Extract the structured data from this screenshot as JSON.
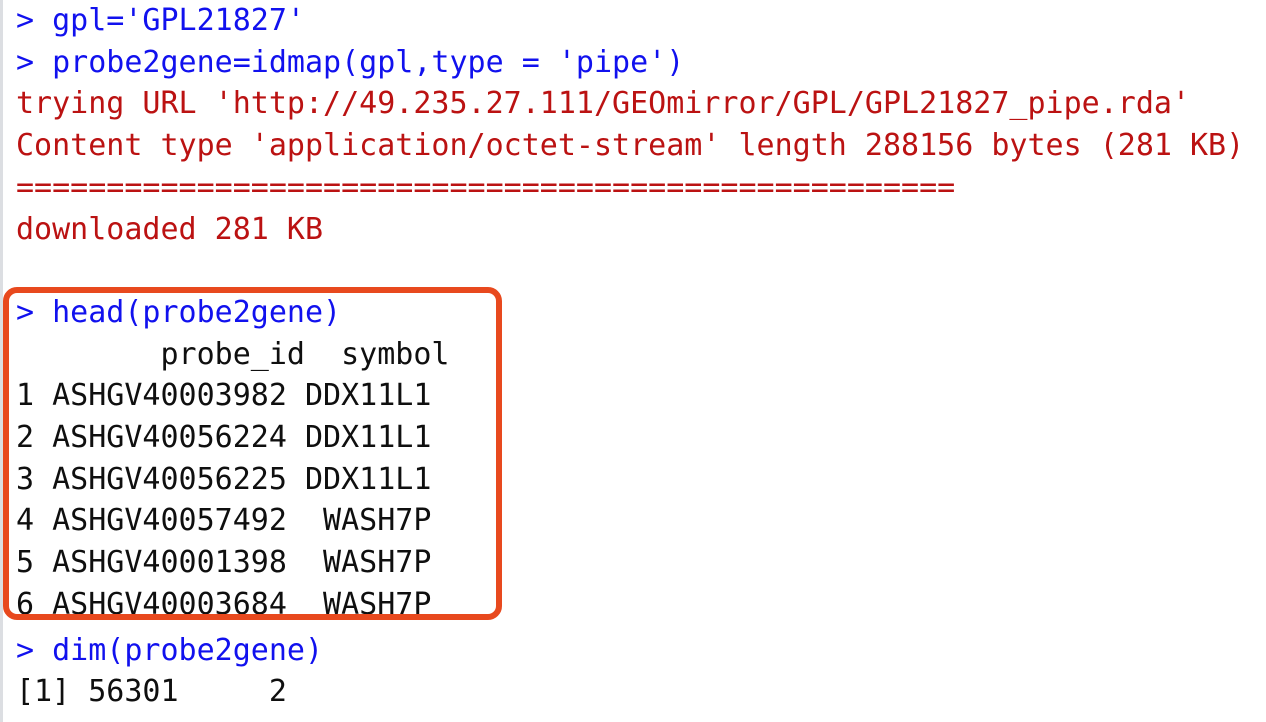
{
  "colors": {
    "command_blue": "#1111ee",
    "output_red": "#bb1212",
    "output_black": "#0f0f0f",
    "highlight_orange": "#e8491e",
    "background": "#ffffff",
    "gutter_gray": "#dcdee2"
  },
  "console": {
    "prompt_symbol": ">",
    "lines": [
      {
        "kind": "command",
        "text": "> gpl='GPL21827'"
      },
      {
        "kind": "command",
        "text": "> probe2gene=idmap(gpl,type = 'pipe')"
      },
      {
        "kind": "output_red",
        "text": "trying URL 'http://49.235.27.111/GEOmirror/GPL/GPL21827_pipe.rda'"
      },
      {
        "kind": "output_red",
        "text": "Content type 'application/octet-stream' length 288156 bytes (281 KB)"
      },
      {
        "kind": "output_red",
        "text": "===================================================="
      },
      {
        "kind": "output_red",
        "text": "downloaded 281 KB"
      },
      {
        "kind": "blank",
        "text": ""
      },
      {
        "kind": "command",
        "text": "> head(probe2gene)"
      },
      {
        "kind": "output_black",
        "text": "        probe_id  symbol"
      },
      {
        "kind": "output_black",
        "text": "1 ASHGV40003982 DDX11L1"
      },
      {
        "kind": "output_black",
        "text": "2 ASHGV40056224 DDX11L1"
      },
      {
        "kind": "output_black",
        "text": "3 ASHGV40056225 DDX11L1"
      },
      {
        "kind": "output_black",
        "text": "4 ASHGV40057492  WASH7P"
      },
      {
        "kind": "output_black",
        "text": "5 ASHGV40001398  WASH7P"
      },
      {
        "kind": "output_black",
        "text": "6 ASHGV40003684  WASH7P"
      },
      {
        "kind": "command",
        "text": "> dim(probe2gene)"
      },
      {
        "kind": "output_black",
        "text": "[1] 56301     2"
      }
    ]
  },
  "commands": {
    "assign_gpl": "> gpl='GPL21827'",
    "idmap_call": "> probe2gene=idmap(gpl,type = 'pipe')",
    "head_call": "> head(probe2gene)",
    "dim_call": "> dim(probe2gene)"
  },
  "download": {
    "trying_url": "trying URL 'http://49.235.27.111/GEOmirror/GPL/GPL21827_pipe.rda'",
    "content_type": "Content type 'application/octet-stream' length 288156 bytes (281 KB)",
    "progress_bar": "====================================================",
    "downloaded": "downloaded 281 KB",
    "url": "http://49.235.27.111/GEOmirror/GPL/GPL21827_pipe.rda",
    "mime_type": "application/octet-stream",
    "length_bytes": "288156",
    "size_label": "281 KB"
  },
  "head_table": {
    "header_line": "        probe_id  symbol",
    "columns": [
      "probe_id",
      "symbol"
    ],
    "rows": [
      {
        "line": "1 ASHGV40003982 DDX11L1",
        "index": "1",
        "probe_id": "ASHGV40003982",
        "symbol": "DDX11L1"
      },
      {
        "line": "2 ASHGV40056224 DDX11L1",
        "index": "2",
        "probe_id": "ASHGV40056224",
        "symbol": "DDX11L1"
      },
      {
        "line": "3 ASHGV40056225 DDX11L1",
        "index": "3",
        "probe_id": "ASHGV40056225",
        "symbol": "DDX11L1"
      },
      {
        "line": "4 ASHGV40057492  WASH7P",
        "index": "4",
        "probe_id": "ASHGV40057492",
        "symbol": "WASH7P"
      },
      {
        "line": "5 ASHGV40001398  WASH7P",
        "index": "5",
        "probe_id": "ASHGV40001398",
        "symbol": "WASH7P"
      },
      {
        "line": "6 ASHGV40003684  WASH7P",
        "index": "6",
        "probe_id": "ASHGV40003684",
        "symbol": "WASH7P"
      }
    ]
  },
  "dim_output": {
    "line": "[1] 56301     2",
    "rows": "56301",
    "cols": "2"
  }
}
